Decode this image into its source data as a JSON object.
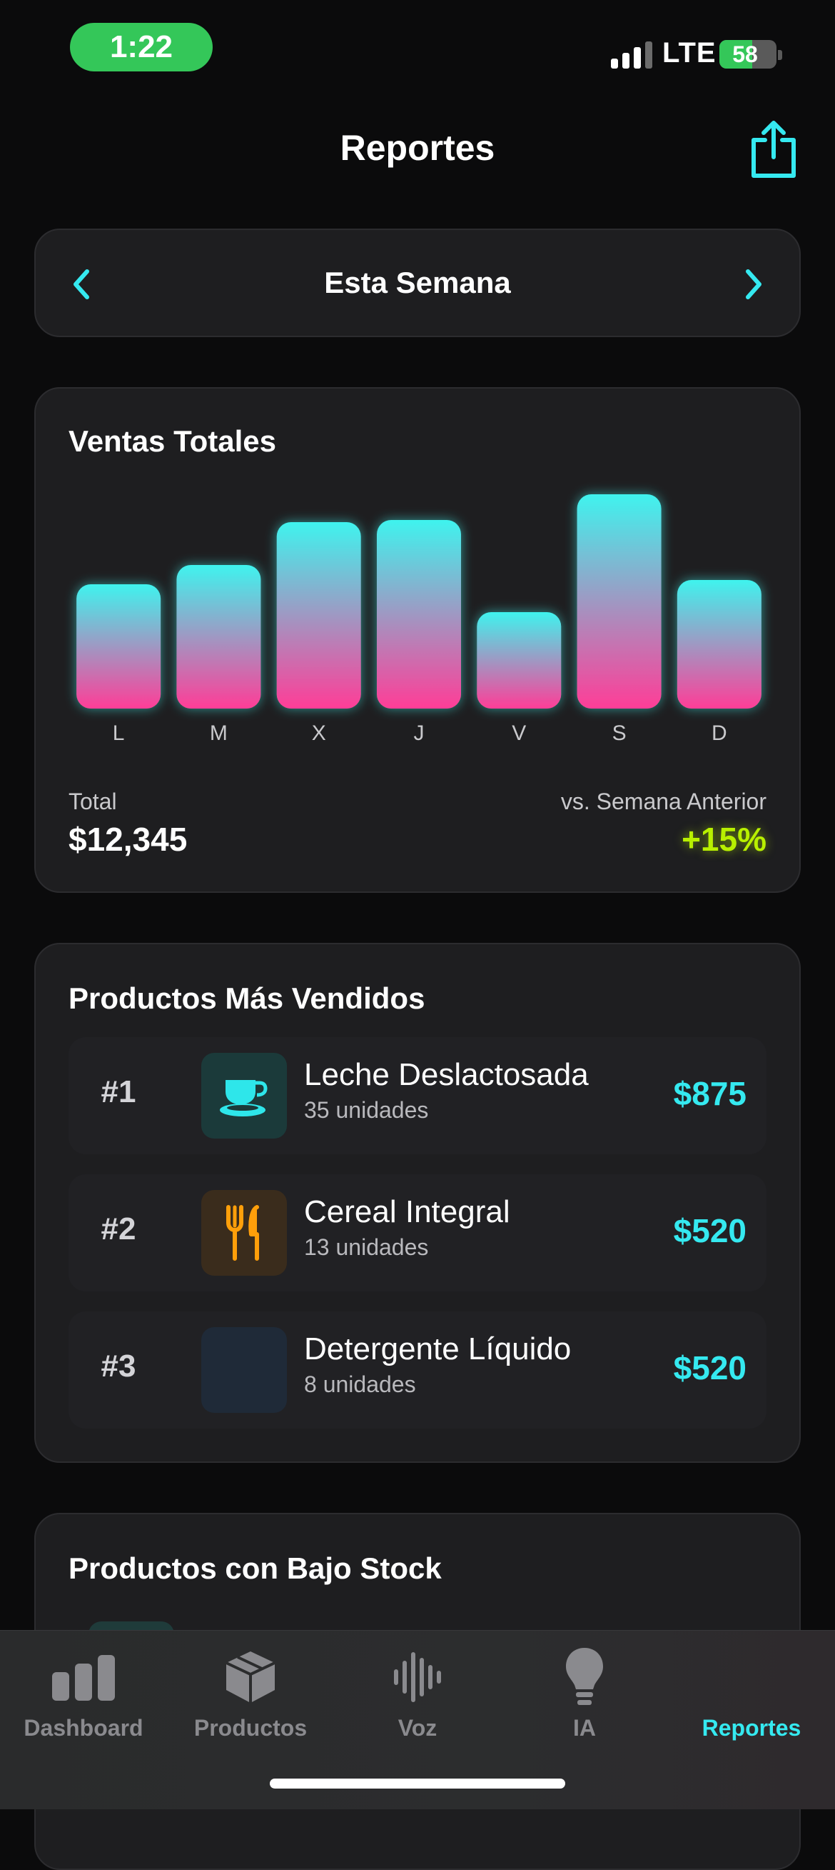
{
  "status_bar": {
    "time": "1:22",
    "network": "LTE",
    "battery_percent": "58",
    "battery_level": 0.58,
    "signal_bars_active": 3,
    "signal_bars_total": 4,
    "time_pill_color": "#34c759"
  },
  "header": {
    "title": "Reportes",
    "share_icon": "share-icon"
  },
  "period": {
    "label": "Esta Semana",
    "prev_icon": "chevron-left-icon",
    "next_icon": "chevron-right-icon"
  },
  "sales": {
    "title": "Ventas Totales",
    "total_label": "Total",
    "total_value": "$12,345",
    "comparison_label": "vs. Semana Anterior",
    "comparison_value": "+15%"
  },
  "chart_data": {
    "type": "bar",
    "title": "Ventas Totales",
    "categories": [
      "L",
      "M",
      "X",
      "J",
      "V",
      "S",
      "D"
    ],
    "values": [
      58,
      67,
      87,
      88,
      45,
      100,
      60
    ],
    "ylim": [
      0,
      100
    ],
    "grid": false,
    "gradient_top": "#3ff3ee",
    "gradient_bottom": "#ff3d97"
  },
  "top_products": {
    "title": "Productos Más Vendidos",
    "items": [
      {
        "rank": "#1",
        "name": "Leche Deslactosada",
        "units": "35 unidades",
        "price": "$875",
        "icon": "coffee-cup-icon",
        "icon_color": "#2ee6ea",
        "icon_bg": "#1b3a3a"
      },
      {
        "rank": "#2",
        "name": "Cereal Integral",
        "units": "13 unidades",
        "price": "$520",
        "icon": "fork-knife-icon",
        "icon_color": "#ff9f0a",
        "icon_bg": "#3a2c1c"
      },
      {
        "rank": "#3",
        "name": "Detergente Líquido",
        "units": "8 unidades",
        "price": "$520",
        "icon": "blank-icon",
        "icon_color": "#1e2a3a",
        "icon_bg": "#1f2a38"
      }
    ]
  },
  "low_stock": {
    "title": "Productos con Bajo Stock"
  },
  "tabbar": {
    "tabs": [
      {
        "label": "Dashboard",
        "icon": "bar-chart-icon"
      },
      {
        "label": "Productos",
        "icon": "box-icon"
      },
      {
        "label": "Voz",
        "icon": "waveform-icon"
      },
      {
        "label": "IA",
        "icon": "lightbulb-icon"
      },
      {
        "label": "Reportes",
        "icon": "reports-icon"
      }
    ],
    "active_color": "#35e9f0",
    "inactive_color": "#8a8a8e"
  }
}
